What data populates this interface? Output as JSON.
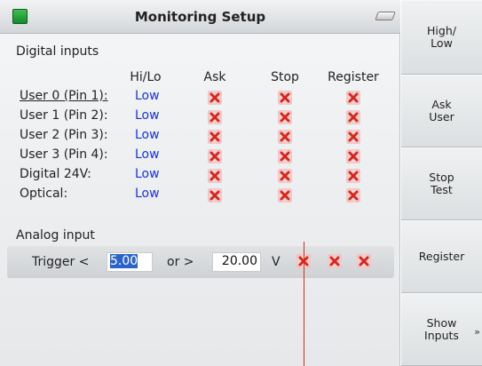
{
  "window": {
    "title": "Monitoring Setup"
  },
  "digital": {
    "section_title": "Digital inputs",
    "columns": [
      "Hi/Lo",
      "Ask",
      "Stop",
      "Register"
    ],
    "rows": [
      {
        "label": "User 0 (Pin 1):",
        "value": "Low",
        "ask": true,
        "stop": true,
        "register": true
      },
      {
        "label": "User 1 (Pin 2):",
        "value": "Low",
        "ask": true,
        "stop": true,
        "register": true
      },
      {
        "label": "User 2 (Pin 3):",
        "value": "Low",
        "ask": true,
        "stop": true,
        "register": true
      },
      {
        "label": "User 3 (Pin 4):",
        "value": "Low",
        "ask": true,
        "stop": true,
        "register": true
      },
      {
        "label": "Digital 24V:",
        "value": "Low",
        "ask": true,
        "stop": true,
        "register": true
      },
      {
        "label": "Optical:",
        "value": "Low",
        "ask": true,
        "stop": true,
        "register": true
      }
    ]
  },
  "analog": {
    "section_title": "Analog input",
    "trigger_label": "Trigger  <",
    "low_value": "5.00",
    "or_label": "or  >",
    "high_value": "20.00",
    "unit": "V"
  },
  "side_buttons": [
    {
      "label_line1": "High/",
      "label_line2": "Low"
    },
    {
      "label_line1": "Ask",
      "label_line2": "User"
    },
    {
      "label_line1": "Stop",
      "label_line2": "Test"
    },
    {
      "label_line1": "Register",
      "label_line2": ""
    },
    {
      "label_line1": "Show",
      "label_line2": "Inputs",
      "chevron": "»"
    }
  ],
  "colors": {
    "value_blue": "#1a32e0",
    "cross_red": "#d8261c",
    "led_green": "#22a33a",
    "marker_line": "#e0271f"
  }
}
